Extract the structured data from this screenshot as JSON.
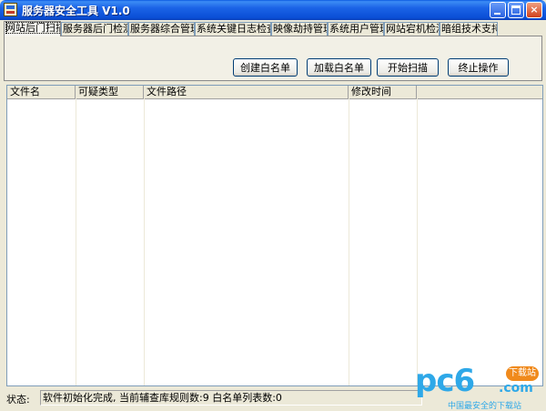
{
  "window": {
    "title": "服务器安全工具 V1.0",
    "icon": "app-icon",
    "controls": {
      "minimize": "minimize-icon",
      "maximize": "maximize-icon",
      "close": "×"
    }
  },
  "tabs": [
    {
      "label": "网站后门扫描",
      "active": true
    },
    {
      "label": "服务器后门检测",
      "active": false
    },
    {
      "label": "服务器综合管理",
      "active": false
    },
    {
      "label": "系统关键日志检查",
      "active": false
    },
    {
      "label": "映像劫持管理",
      "active": false
    },
    {
      "label": "系统用户管理",
      "active": false
    },
    {
      "label": "网站宕机检测",
      "active": false
    },
    {
      "label": "暗组技术支持",
      "active": false
    }
  ],
  "actions": {
    "create_whitelist": "创建白名单",
    "load_whitelist": "加载白名单",
    "start_scan": "开始扫描",
    "stop": "终止操作"
  },
  "list": {
    "columns": [
      "文件名",
      "可疑类型",
      "文件路径",
      "修改时间"
    ],
    "rows": []
  },
  "status": {
    "label": "状态:",
    "message": "软件初始化完成, 当前辅查库规则数:9 白名单列表数:0"
  },
  "watermark": {
    "brand": "pc6",
    "suffix": ".com",
    "badge": "下载站",
    "tagline": "中国最安全的下载站"
  },
  "colors": {
    "titlebar": "#0a4fd6",
    "window_bg": "#ece9d8",
    "watermark": "#2ea8e8",
    "badge": "#f08a1c"
  }
}
